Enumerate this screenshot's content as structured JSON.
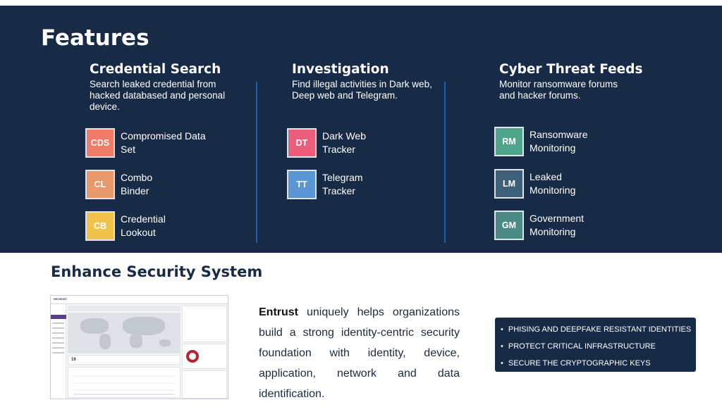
{
  "features": {
    "title": "Features",
    "columns": [
      {
        "heading": "Credential Search",
        "description": "Search leaked credential from hacked databased and personal device.",
        "items": [
          {
            "abbr": "CDS",
            "label": "Compromised Data\nSet",
            "color": "#ef7b68"
          },
          {
            "abbr": "CL",
            "label": "Combo\nBinder",
            "color": "#e9986b"
          },
          {
            "abbr": "CB",
            "label": "Credential\nLookout",
            "color": "#f0c24a"
          }
        ]
      },
      {
        "heading": "Investigation",
        "description": "Find illegal activities in Dark web, Deep web and Telegram.",
        "items": [
          {
            "abbr": "DT",
            "label": "Dark Web\nTracker",
            "color": "#ea5d7c"
          },
          {
            "abbr": "TT",
            "label": "Telegram\nTracker",
            "color": "#5a95d4"
          }
        ]
      },
      {
        "heading": "Cyber Threat Feeds",
        "description": "Monitor ransomware forums and hacker forums.",
        "items": [
          {
            "abbr": "RM",
            "label": "Ransomware\nMonitoring",
            "color": "#4fa58a"
          },
          {
            "abbr": "LM",
            "label": "Leaked\nMonitoring",
            "color": "#3e5f7a"
          },
          {
            "abbr": "GM",
            "label": "Government\nMonitoring",
            "color": "#4c8a85"
          }
        ]
      }
    ]
  },
  "enhance": {
    "title": "Enhance Security System",
    "brand": "Entrust",
    "paragraph": "uniquely helps organizations build a strong identity-centric security foundation with identity, device, application, network and data identification.",
    "bullets": [
      "PHISING AND DEEPFAKE RESISTANT IDENTITIES",
      "PROTECT CRITICAL INFRASTRUCTURE",
      "SECURE THE CRYPTOGRAPHIC KEYS"
    ],
    "screenshot": {
      "logo": "SECRUST",
      "stat": "19",
      "donut_value": "3%"
    }
  },
  "colors": {
    "navy": "#172b47",
    "divider": "#1a5fb4",
    "accent_purple": "#5b3d8f"
  }
}
